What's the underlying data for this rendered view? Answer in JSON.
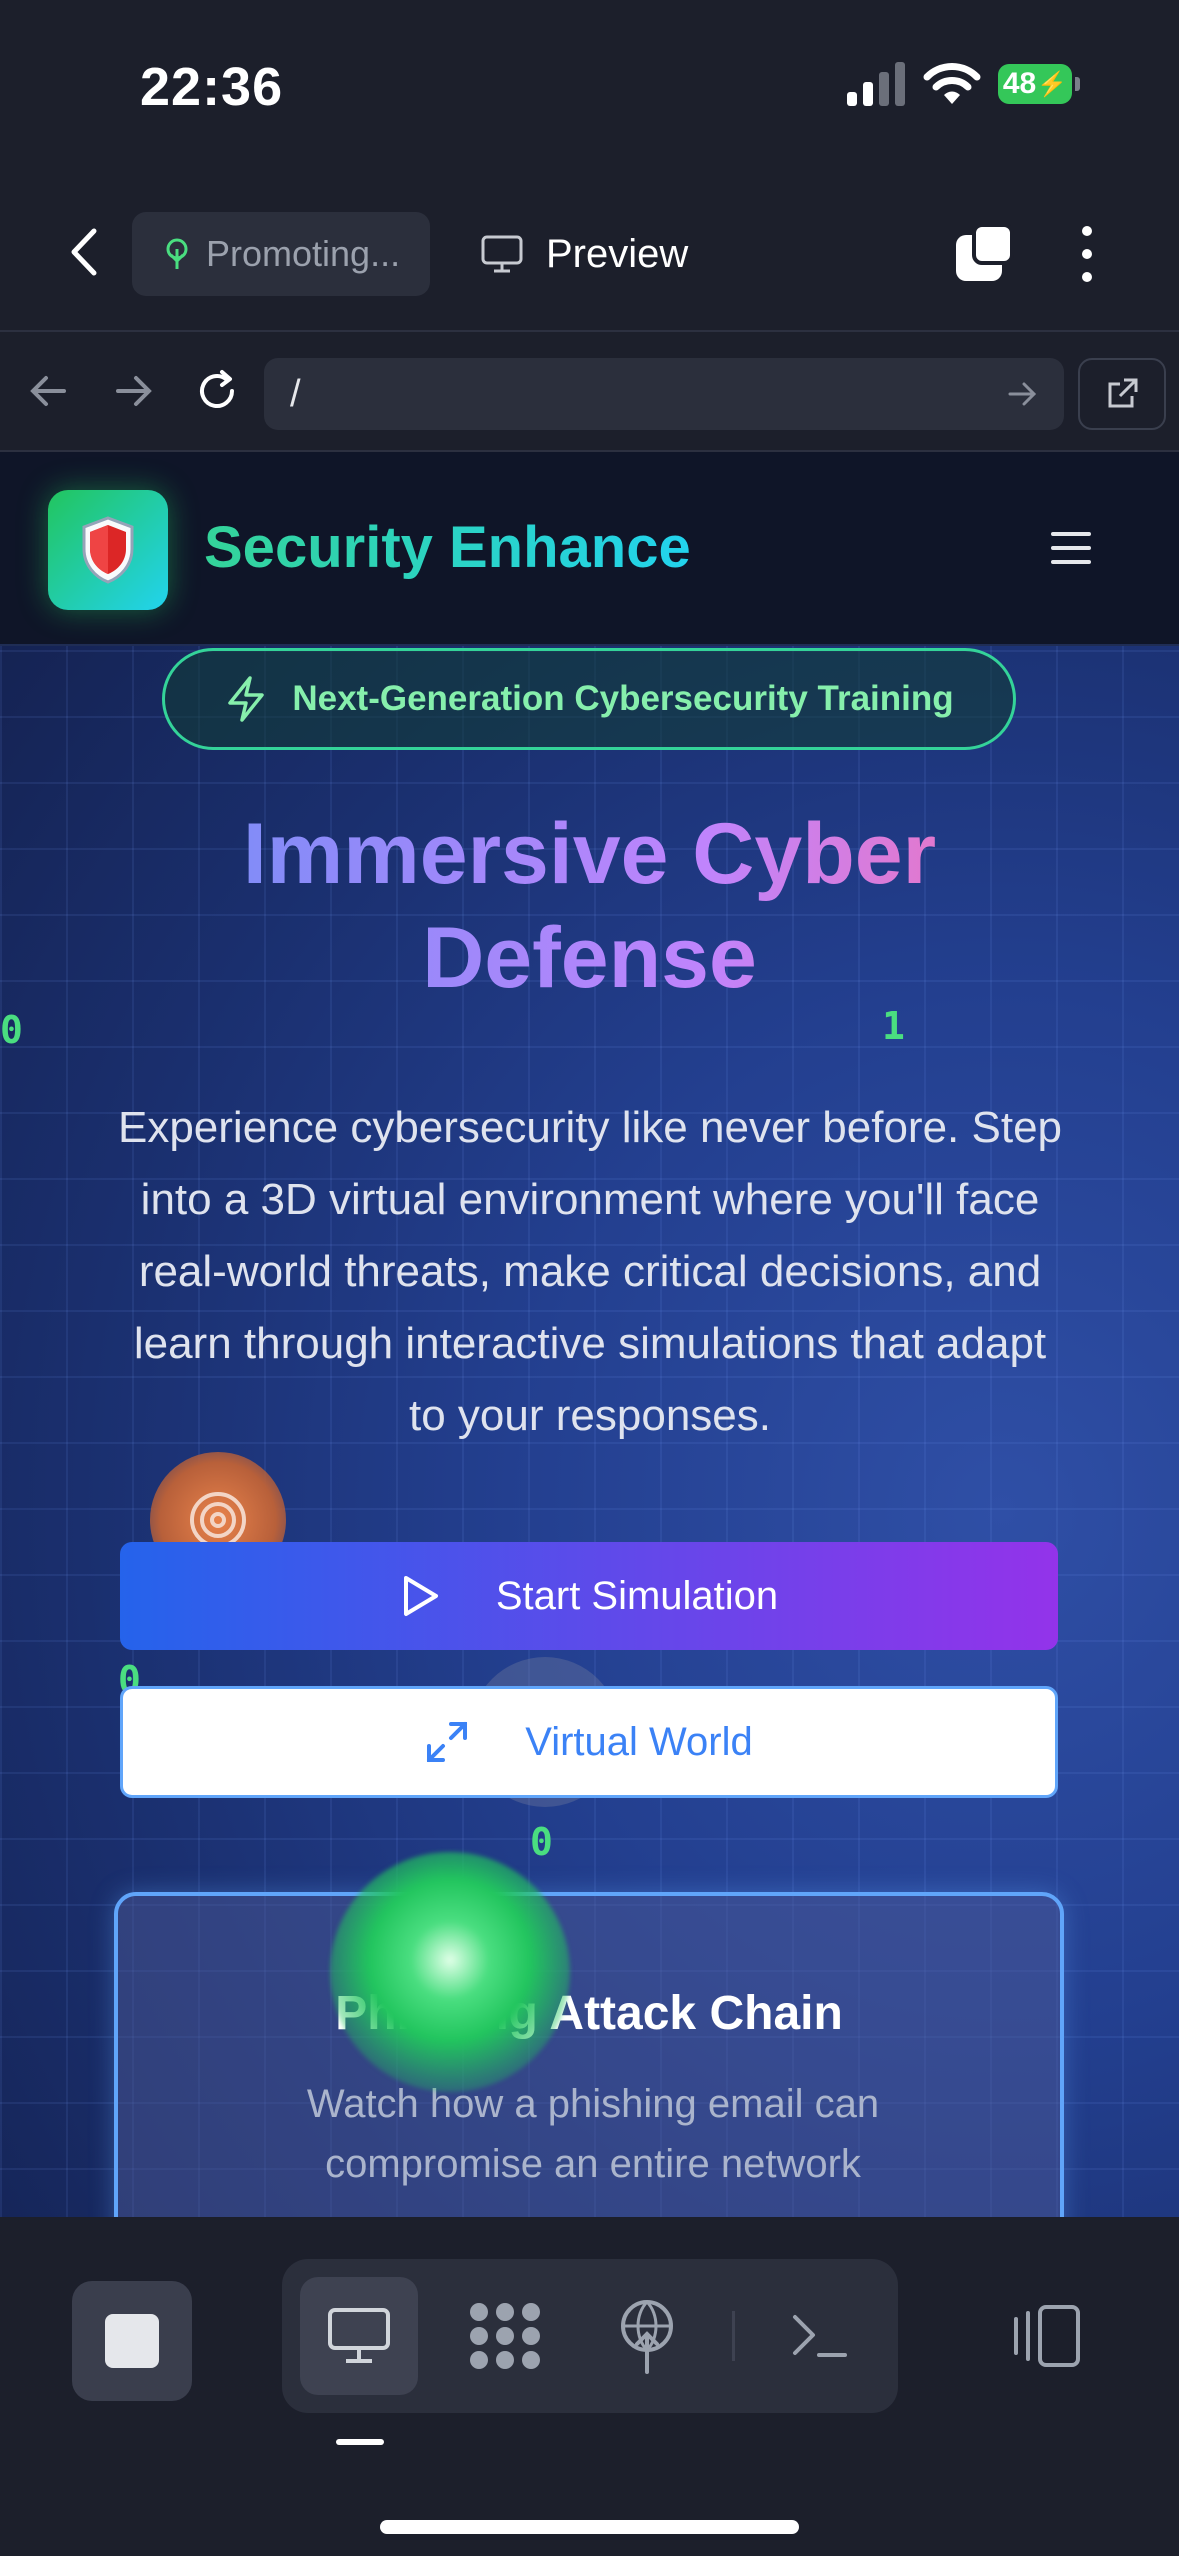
{
  "status_bar": {
    "time": "22:36",
    "battery": "48"
  },
  "app_toolbar": {
    "project_pill": "Promoting...",
    "preview_label": "Preview"
  },
  "url_bar": {
    "url": "/"
  },
  "site": {
    "brand": "Security Enhance",
    "badge": "Next-Generation Cybersecurity Training",
    "headline_line1": "Immersive Cyber",
    "headline_line2": "Defense",
    "description": "Experience cybersecurity like never before. Step into a 3D virtual environment where you'll face real-world threats, make critical decisions, and learn through interactive simulations that adapt to your responses.",
    "start_button": "Start Simulation",
    "virtual_button": "Virtual World",
    "binary_digits": [
      "0",
      "1",
      "0",
      "0"
    ],
    "card": {
      "title": "Phishing Attack Chain",
      "description": "Watch how a phishing email can compromise an entire network"
    }
  },
  "colors": {
    "accent_green": "#34d399",
    "accent_blue": "#2563eb",
    "accent_purple": "#9333ea",
    "battery_green": "#34c759"
  },
  "dock": {
    "tabs": [
      "desktop-icon",
      "apps-icon",
      "network-icon",
      "terminal-icon"
    ],
    "active_tab": "desktop-icon"
  }
}
